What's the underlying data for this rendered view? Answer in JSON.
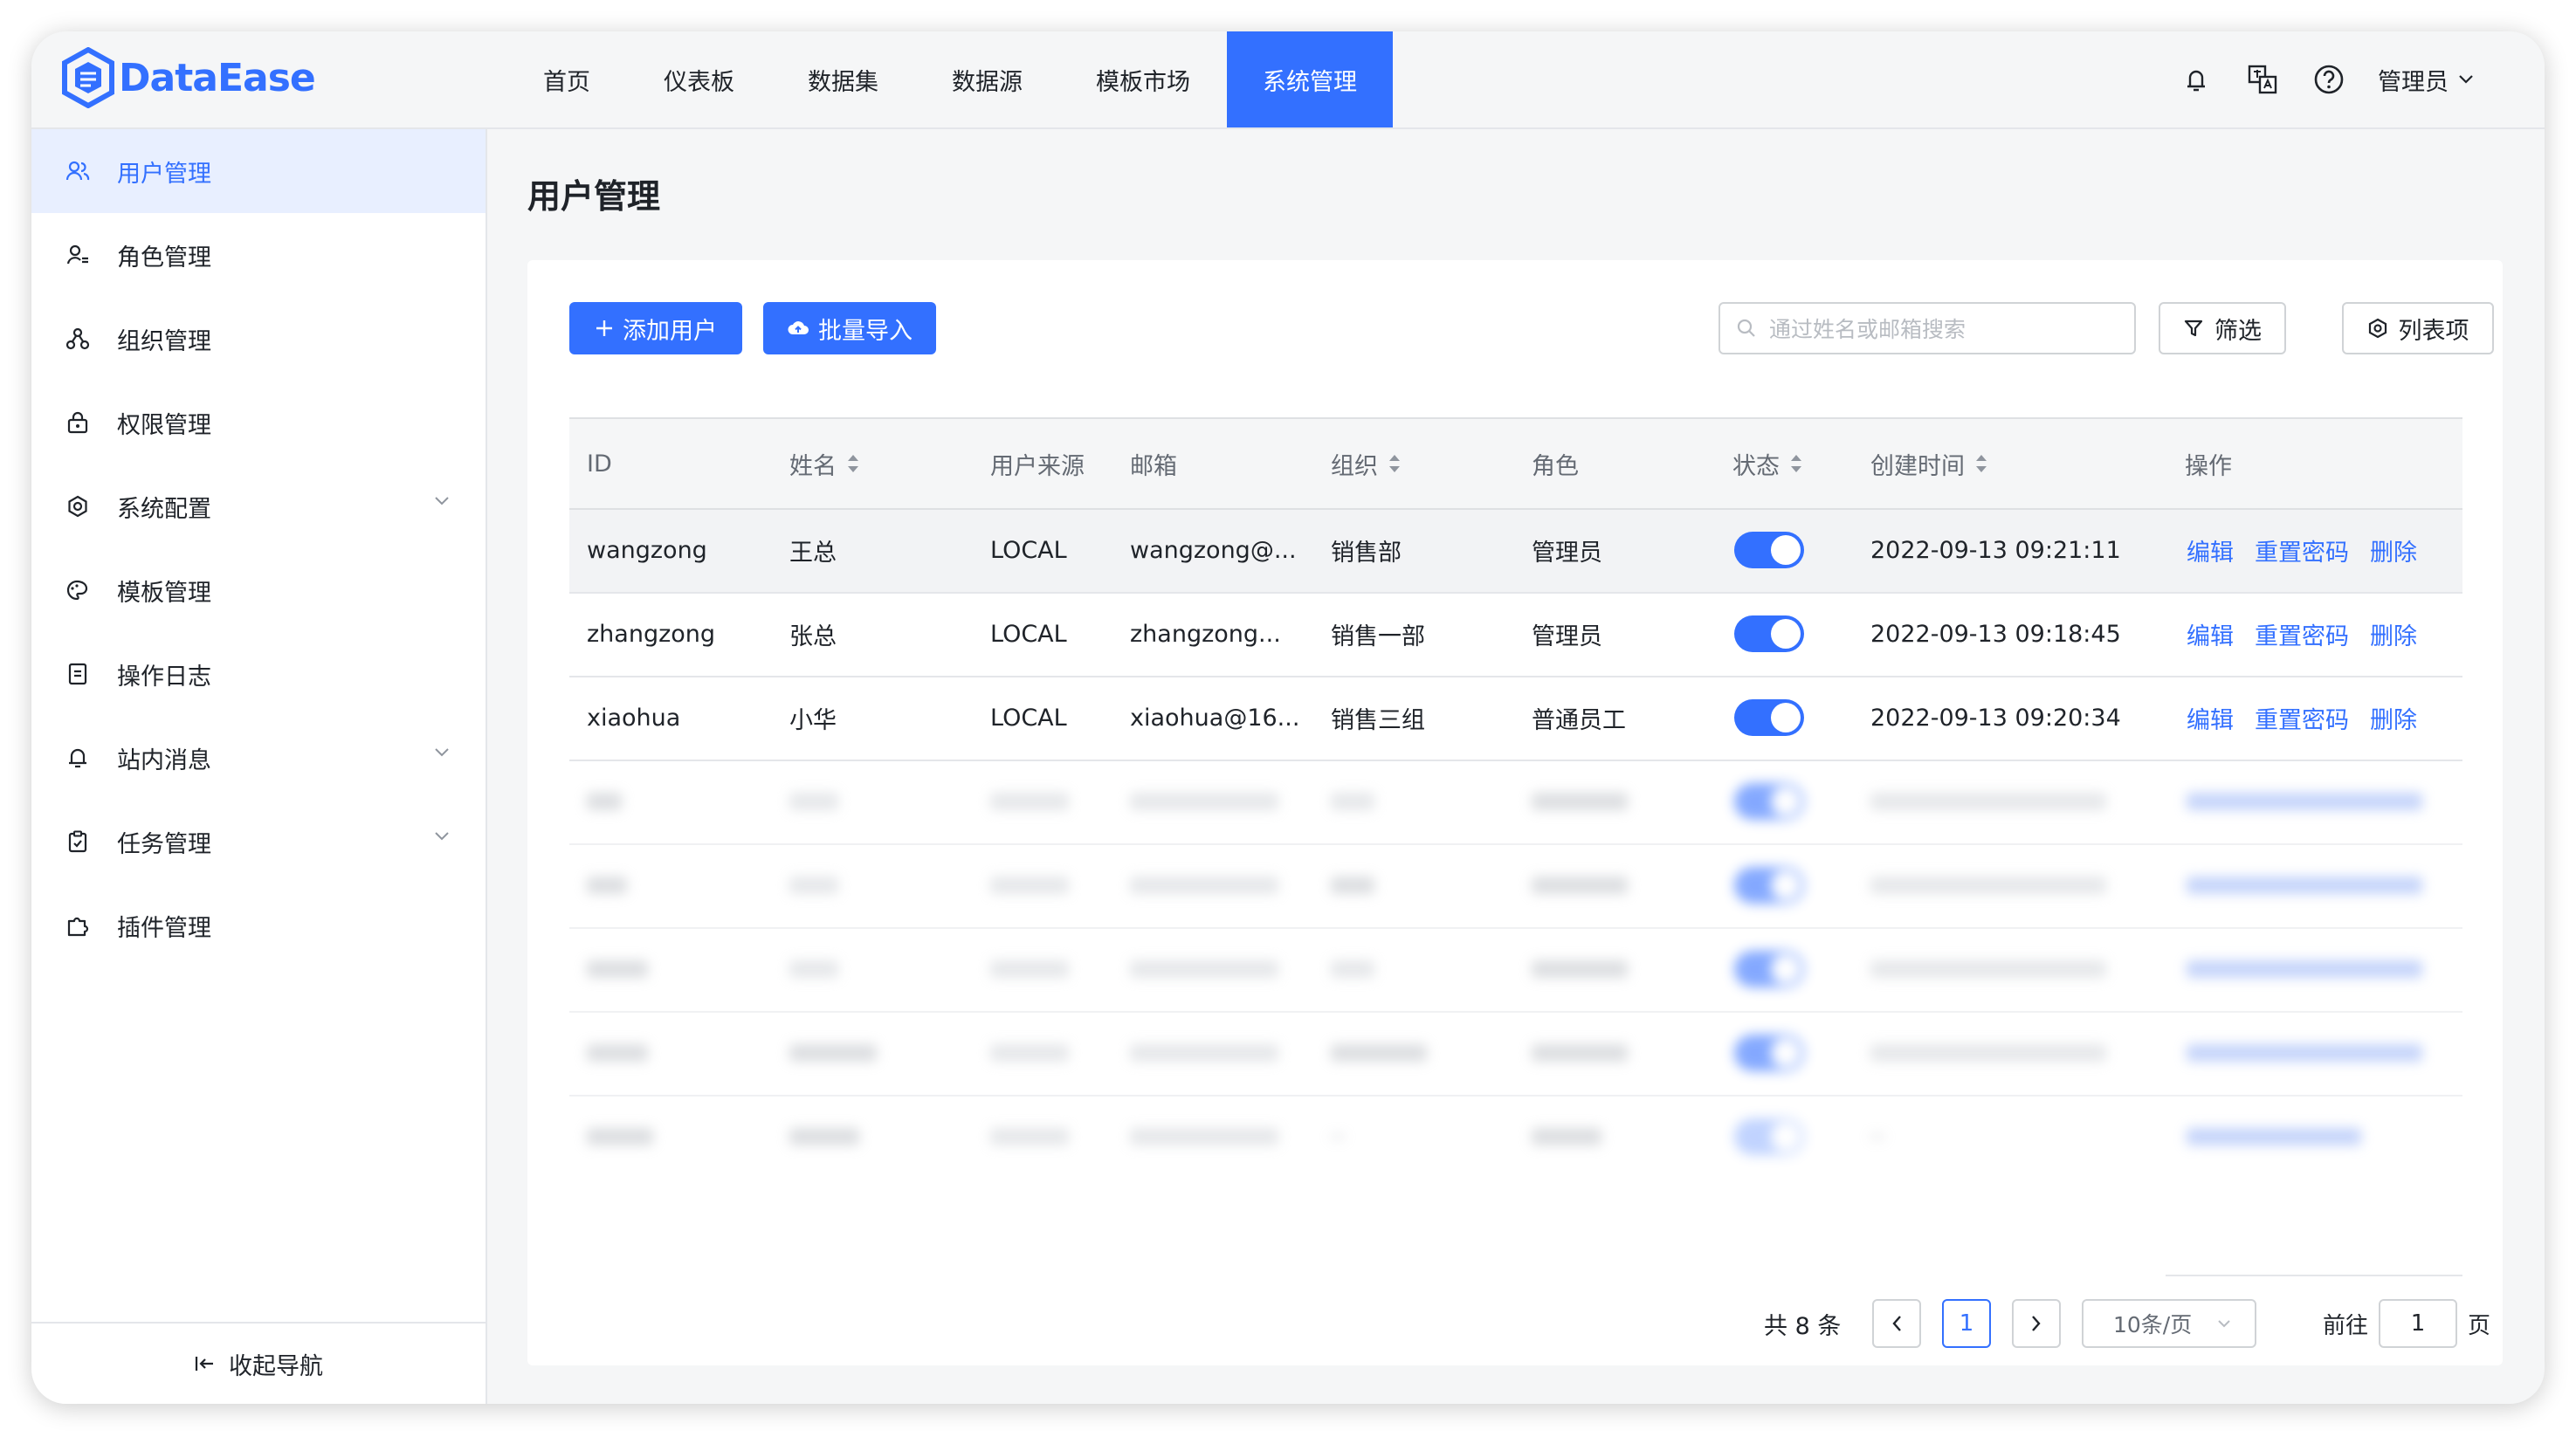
{
  "app": {
    "name": "DataEase"
  },
  "nav": {
    "items": [
      {
        "label": "首页"
      },
      {
        "label": "仪表板"
      },
      {
        "label": "数据集"
      },
      {
        "label": "数据源"
      },
      {
        "label": "模板市场"
      },
      {
        "label": "系统管理"
      }
    ],
    "active": "系统管理"
  },
  "header": {
    "user_label": "管理员"
  },
  "sidebar": {
    "items": [
      {
        "label": "用户管理",
        "icon": "users-icon"
      },
      {
        "label": "角色管理",
        "icon": "role-icon"
      },
      {
        "label": "组织管理",
        "icon": "org-icon"
      },
      {
        "label": "权限管理",
        "icon": "lock-icon"
      },
      {
        "label": "系统配置",
        "icon": "gear-icon"
      },
      {
        "label": "模板管理",
        "icon": "palette-icon"
      },
      {
        "label": "操作日志",
        "icon": "log-icon"
      },
      {
        "label": "站内消息",
        "icon": "bell-icon"
      },
      {
        "label": "任务管理",
        "icon": "task-icon"
      },
      {
        "label": "插件管理",
        "icon": "plugin-icon"
      }
    ],
    "collapse_label": "收起导航"
  },
  "page": {
    "title": "用户管理"
  },
  "toolbar": {
    "add_label": "添加用户",
    "import_label": "批量导入",
    "search_placeholder": "通过姓名或邮箱搜索",
    "filter_label": "筛选",
    "columns_label": "列表项"
  },
  "table": {
    "headers": [
      "ID",
      "姓名",
      "用户来源",
      "邮箱",
      "组织",
      "角色",
      "状态",
      "创建时间",
      "操作"
    ],
    "actions": [
      "编辑",
      "重置密码",
      "删除"
    ],
    "rows": [
      {
        "id": "wangzong",
        "name": "王总",
        "source": "LOCAL",
        "email": "wangzong@...",
        "org": "销售部",
        "role": "管理员",
        "enabled": true,
        "created": "2022-09-13 09:21:11"
      },
      {
        "id": "zhangzong",
        "name": "张总",
        "source": "LOCAL",
        "email": "zhangzong...",
        "org": "销售一部",
        "role": "管理员",
        "enabled": true,
        "created": "2022-09-13 09:18:45"
      },
      {
        "id": "xiaohua",
        "name": "小华",
        "source": "LOCAL",
        "email": "xiaohua@16...",
        "org": "销售三组",
        "role": "普通员工",
        "enabled": true,
        "created": "2022-09-13 09:20:34"
      }
    ]
  },
  "pagination": {
    "total_label": "共 8 条",
    "current_page": "1",
    "page_size_label": "10条/页",
    "goto_label": "前往",
    "goto_value": "1",
    "page_suffix": "页"
  },
  "colors": {
    "accent": "#3370ff",
    "background": "#f5f6f7"
  }
}
